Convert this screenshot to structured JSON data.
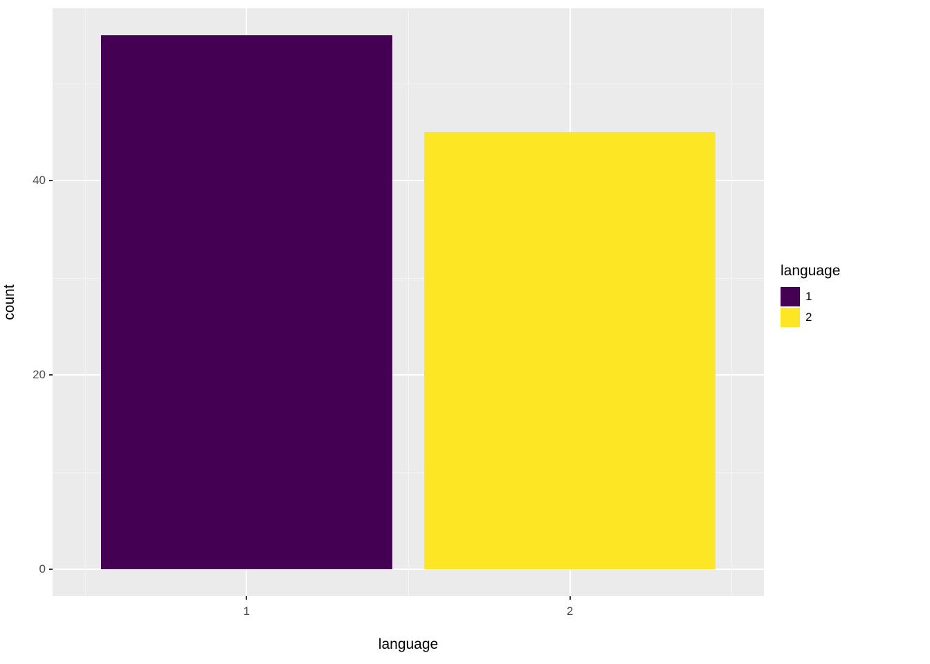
{
  "chart_data": {
    "type": "bar",
    "categories": [
      "1",
      "2"
    ],
    "values": [
      55,
      45
    ],
    "title": "",
    "xlabel": "language",
    "ylabel": "count",
    "ylim": [
      0,
      57.5
    ],
    "ybreaks": [
      0,
      20,
      40
    ],
    "yminor": [
      10,
      30,
      50
    ],
    "bar_colors": [
      "#440154",
      "#fde725"
    ],
    "legend_title": "language",
    "legend_labels": [
      "1",
      "2"
    ]
  }
}
